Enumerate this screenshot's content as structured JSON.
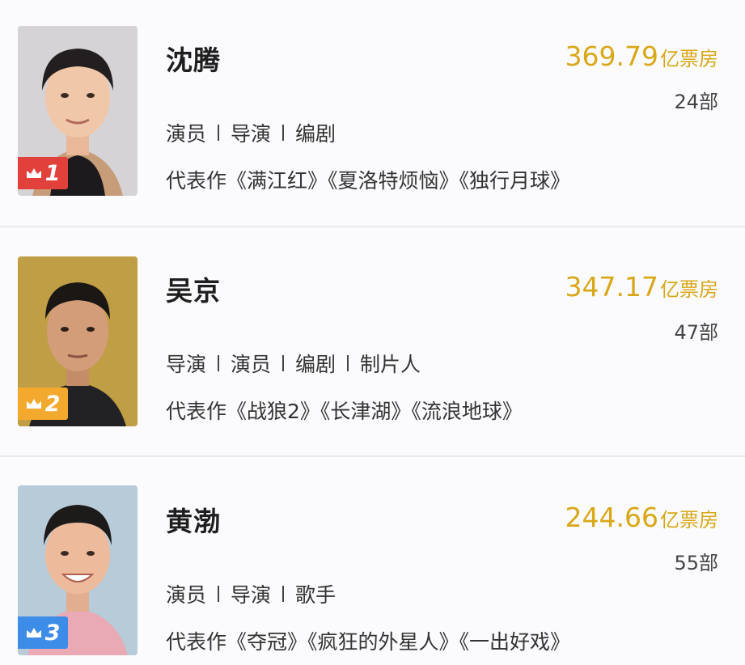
{
  "colors": {
    "box_office": "#d9a717",
    "rank_1": "#e2403b",
    "rank_2": "#f3a82e",
    "rank_3": "#3d8de8"
  },
  "entries": [
    {
      "rank": "1",
      "name": "沈腾",
      "box_office_value": "369.79",
      "box_office_unit": "亿票房",
      "film_count": "24部",
      "roles": [
        "演员",
        "导演",
        "编剧"
      ],
      "works": "代表作《满江红》《夏洛特烦恼》《独行月球》",
      "badge_icon": "crown-icon"
    },
    {
      "rank": "2",
      "name": "吴京",
      "box_office_value": "347.17",
      "box_office_unit": "亿票房",
      "film_count": "47部",
      "roles": [
        "导演",
        "演员",
        "编剧",
        "制片人"
      ],
      "works": "代表作《战狼2》《长津湖》《流浪地球》",
      "badge_icon": "crown-icon"
    },
    {
      "rank": "3",
      "name": "黄渤",
      "box_office_value": "244.66",
      "box_office_unit": "亿票房",
      "film_count": "55部",
      "roles": [
        "演员",
        "导演",
        "歌手"
      ],
      "works": "代表作《夺冠》《疯狂的外星人》《一出好戏》",
      "badge_icon": "crown-icon"
    }
  ]
}
